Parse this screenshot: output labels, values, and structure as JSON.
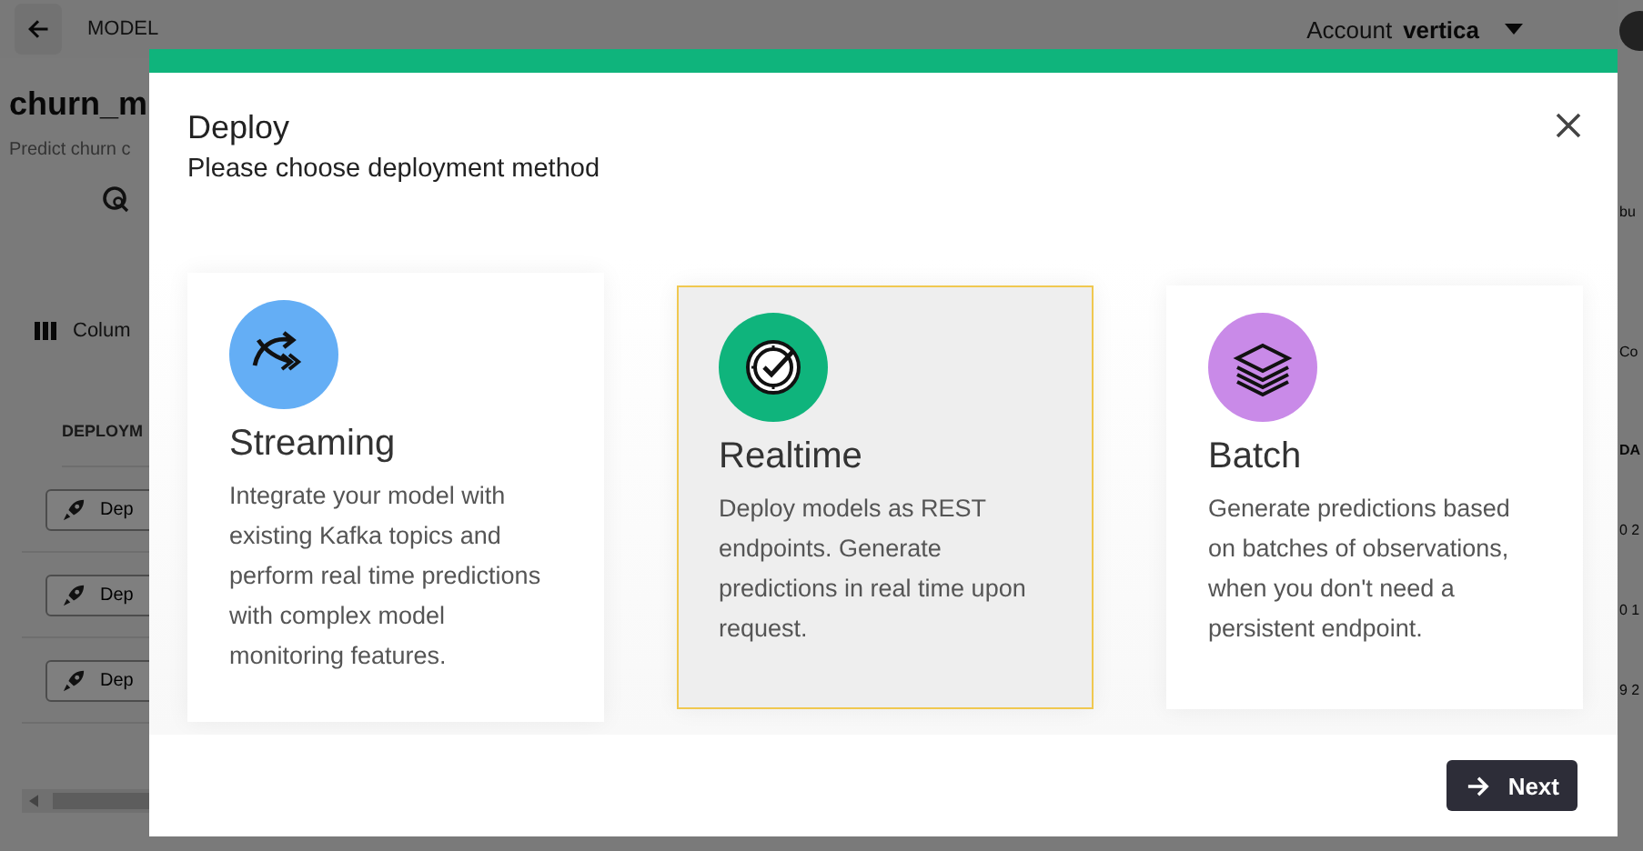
{
  "background": {
    "header": {
      "section": "MODEL",
      "account_label": "Account",
      "account": "vertica"
    },
    "title": "churn_m",
    "description": "Predict churn c",
    "toolbar_label": "Colum",
    "column_header": "DEPLOYM",
    "row_buttons": [
      "Dep",
      "Dep",
      "Dep"
    ],
    "right_edge": [
      "bu",
      "Co",
      "DA",
      "0 2",
      "0 1",
      "9 2"
    ]
  },
  "dialog": {
    "title": "Deploy",
    "subtitle": "Please choose deployment method",
    "methods": [
      {
        "kind": "streaming",
        "name": "Streaming",
        "description": "Integrate your model with existing Kafka topics and perform real time predictions with complex model monitoring features.",
        "color": "#64aef5",
        "selected": false
      },
      {
        "kind": "realtime",
        "name": "Realtime",
        "description": "Deploy models as REST endpoints. Generate predictions in real time upon request.",
        "color": "#0fb47c",
        "selected": true
      },
      {
        "kind": "batch",
        "name": "Batch",
        "description": "Generate predictions based on batches of observations, when you don't need a persistent endpoint.",
        "color": "#c98ae8",
        "selected": false
      }
    ],
    "next_button": "Next"
  }
}
